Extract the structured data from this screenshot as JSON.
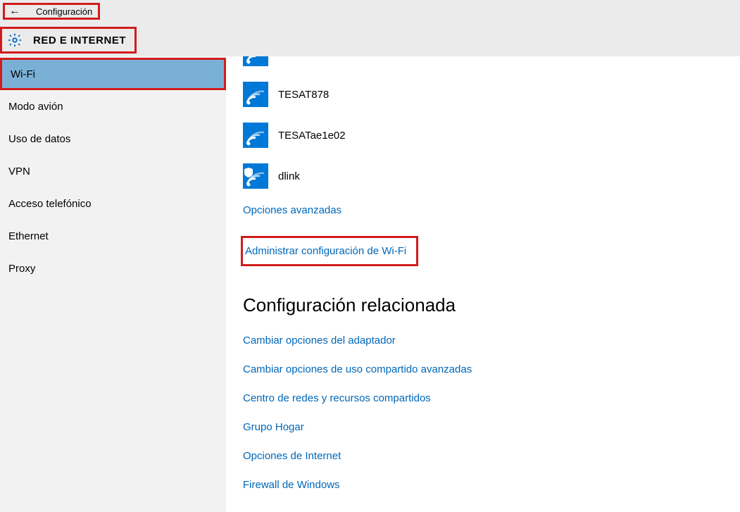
{
  "header": {
    "app_title": "Configuración",
    "section_title": "RED E INTERNET"
  },
  "sidebar": {
    "items": [
      {
        "label": "Wi-Fi",
        "selected": true
      },
      {
        "label": "Modo avión"
      },
      {
        "label": "Uso de datos"
      },
      {
        "label": "VPN"
      },
      {
        "label": "Acceso telefónico"
      },
      {
        "label": "Ethernet"
      },
      {
        "label": "Proxy"
      }
    ]
  },
  "networks": [
    {
      "name": "",
      "secured": false
    },
    {
      "name": "TESAT878",
      "secured": false
    },
    {
      "name": "TESATae1e02",
      "secured": false
    },
    {
      "name": "dlink",
      "secured": true
    }
  ],
  "links": {
    "advanced": "Opciones avanzadas",
    "manage": "Administrar configuración de Wi-Fi"
  },
  "related": {
    "heading": "Configuración relacionada",
    "items": [
      "Cambiar opciones del adaptador",
      "Cambiar opciones de uso compartido avanzadas",
      "Centro de redes y recursos compartidos",
      "Grupo Hogar",
      "Opciones de Internet",
      "Firewall de Windows"
    ]
  }
}
